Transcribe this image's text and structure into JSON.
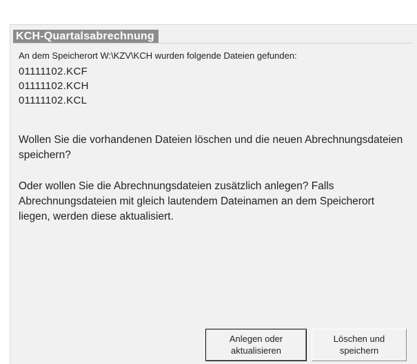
{
  "dialog": {
    "title": "KCH-Quartalsabrechnung",
    "found_intro": "An dem Speicherort W:\\KZV\\KCH wurden folgende Dateien gefunden:",
    "files": [
      "01111102.KCF",
      "01111102.KCH",
      "01111102.KCL"
    ],
    "question1": "Wollen Sie die vorhandenen Dateien löschen und die neuen Abrechnungsdateien speichern?",
    "question2": "Oder wollen Sie die Abrechnungsdateien zusätzlich anlegen? Falls Abrechnungsdateien mit gleich lautendem Dateinamen an dem Speicherort liegen, werden diese aktualisiert."
  },
  "buttons": {
    "create_update": {
      "line1": "Anlegen oder",
      "line2": "aktualisieren"
    },
    "delete_save": {
      "line1": "Löschen und",
      "line2": "speichern"
    }
  }
}
